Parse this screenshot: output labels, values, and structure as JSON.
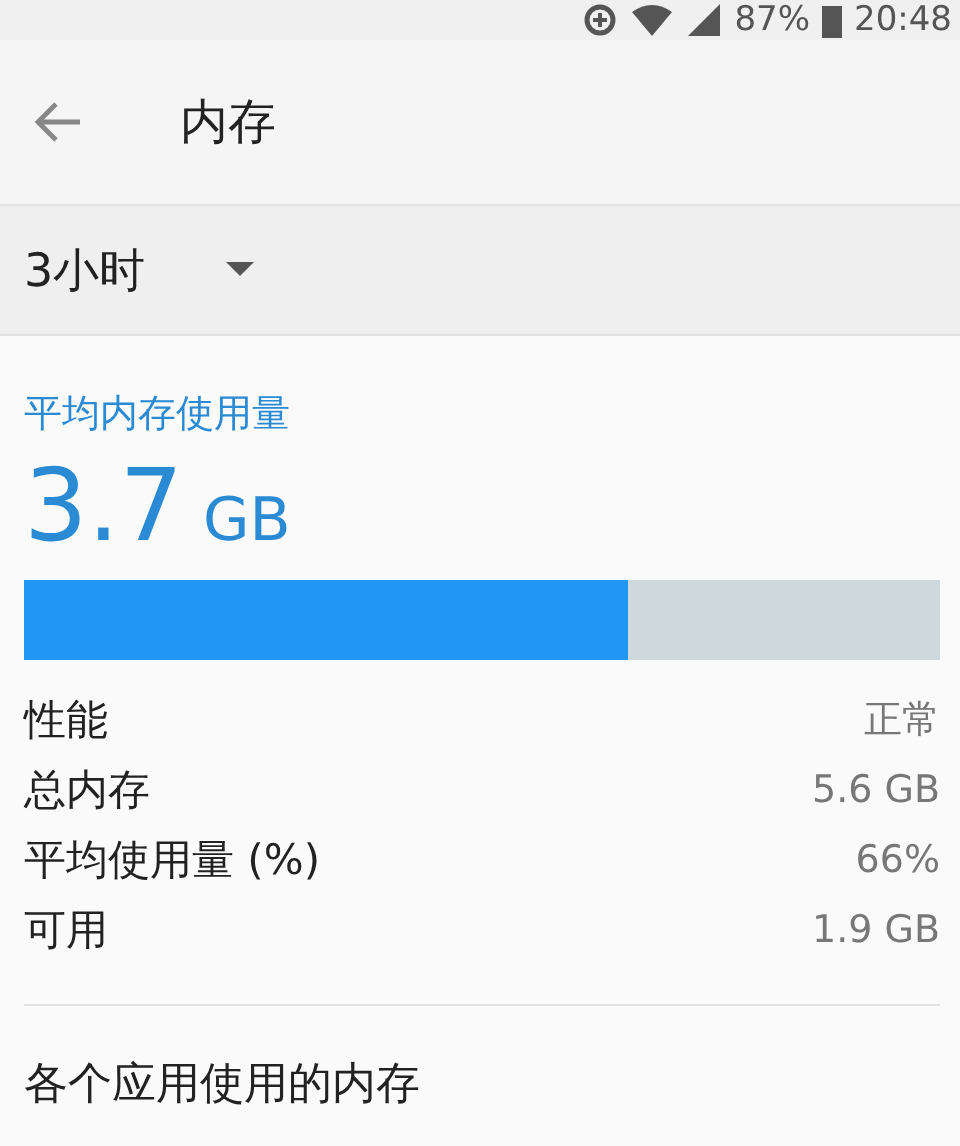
{
  "status_bar": {
    "battery": "87%",
    "time": "20:48"
  },
  "app_bar": {
    "title": "内存"
  },
  "period": {
    "value": "3小时"
  },
  "summary": {
    "label": "平均内存使用量",
    "amount": "3.7",
    "unit": "GB",
    "level": 0.66
  },
  "stats": [
    {
      "label": "性能",
      "value": "正常"
    },
    {
      "label": "总内存",
      "value": "5.6 GB"
    },
    {
      "label": "平均使用量 (%)",
      "value": "66%"
    },
    {
      "label": "可用",
      "value": "1.9 GB"
    }
  ],
  "section": {
    "title": "各个应用使用的内存"
  }
}
